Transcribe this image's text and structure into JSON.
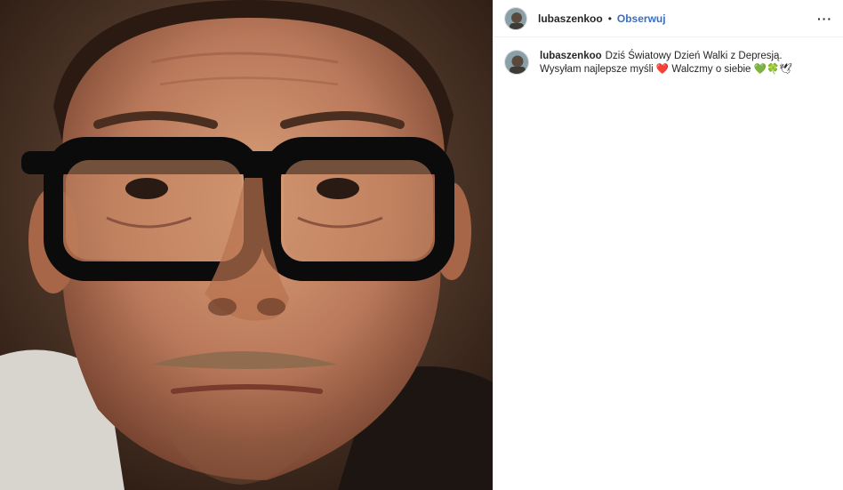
{
  "post": {
    "username": "lubaszenkoo",
    "separator": "•",
    "follow_label": "Obserwuj",
    "more_label": "···",
    "caption": "Dziś Światowy Dzień Walki z Depresją. Wysyłam najlepsze myśli ❤️ Walczmy o siebie 💚🍀🕊",
    "image_description_icon": "portrait-photo"
  },
  "colors": {
    "accent": "#3a6ec2",
    "text": "#262626",
    "divider": "#efefef"
  }
}
